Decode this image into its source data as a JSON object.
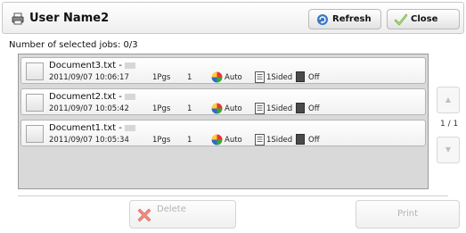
{
  "header": {
    "title": "User Name2",
    "icon": "printer-icon",
    "refresh_label": "Refresh",
    "close_label": "Close"
  },
  "selection": {
    "count_text": "Number of selected jobs: 0/3"
  },
  "jobs": [
    {
      "name": "Document3.txt -",
      "datetime": "2011/09/07 10:06:17",
      "pages": "1Pgs",
      "copies": "1",
      "color": "Auto",
      "sides": "1Sided",
      "staple": "Off"
    },
    {
      "name": "Document2.txt -",
      "datetime": "2011/09/07 10:05:42",
      "pages": "1Pgs",
      "copies": "1",
      "color": "Auto",
      "sides": "1Sided",
      "staple": "Off"
    },
    {
      "name": "Document1.txt -",
      "datetime": "2011/09/07 10:05:34",
      "pages": "1Pgs",
      "copies": "1",
      "color": "Auto",
      "sides": "1Sided",
      "staple": "Off"
    }
  ],
  "pager": {
    "indicator": "1 / 1",
    "up_glyph": "▲",
    "down_glyph": "▼"
  },
  "footer": {
    "delete_label": "Delete",
    "print_label": "Print"
  },
  "colors": {
    "refresh_icon": "#3a78c2",
    "close_check": "#6bb33a",
    "delete_x": "#e04a3a",
    "disabled_text": "#b3b3b3"
  }
}
